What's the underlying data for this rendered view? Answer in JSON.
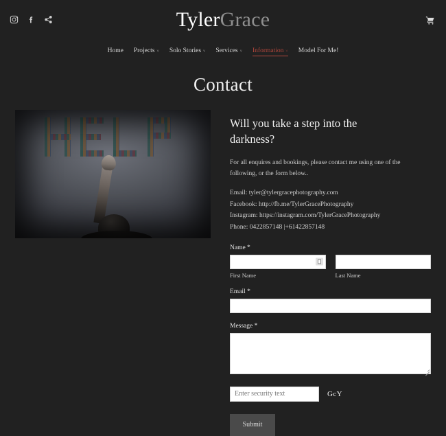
{
  "site": {
    "brand_first": "Tyler",
    "brand_second": "Grace",
    "social": [
      {
        "name": "instagram-icon",
        "label": "Instagram"
      },
      {
        "name": "facebook-icon",
        "label": "Facebook"
      },
      {
        "name": "share-icon",
        "label": "Share"
      }
    ],
    "cart_label": "Cart"
  },
  "nav": {
    "items": [
      {
        "label": "Home",
        "caret": "",
        "active": false
      },
      {
        "label": "Projects",
        "caret": "˅",
        "active": false
      },
      {
        "label": "Solo Stories",
        "caret": "˅",
        "active": false
      },
      {
        "label": "Services",
        "caret": "˅",
        "active": false
      },
      {
        "label": "Information",
        "caret": "˅",
        "active": true
      },
      {
        "label": "Model For Me!",
        "caret": "",
        "active": false
      }
    ],
    "active_color": "#b5473c"
  },
  "page": {
    "title": "Contact"
  },
  "photo": {
    "alt": "Person reaching up toward the word HELP spelled out in photographs on a dark wall",
    "word": "HELP"
  },
  "main": {
    "headline": "Will you take a step into the darkness?",
    "intro": "For all enquires and bookings, please contact me using one of the following, or the form below..",
    "details": {
      "email": "Email: tyler@tylergracephotography.com",
      "facebook": "Facebook: http://fb.me/TylerGracePhotography",
      "instagram": "Instagram: https://instagram.com/TylerGracePhotography",
      "phone": "Phone: 0422857148  |+61422857148"
    }
  },
  "form": {
    "name_label": "Name *",
    "first_name_value": "",
    "first_name_placeholder": "",
    "first_name_sublabel": "First Name",
    "last_name_value": "",
    "last_name_placeholder": "",
    "last_name_sublabel": "Last Name",
    "email_label": "Email *",
    "email_value": "",
    "email_placeholder": "",
    "message_label": "Message *",
    "message_value": "",
    "message_placeholder": "",
    "captcha_placeholder": "Enter security text",
    "captcha_value": "",
    "captcha_text": "GcY",
    "submit_label": "Submit"
  },
  "colors": {
    "background": "#212121",
    "accent": "#b5473c",
    "text": "#e8e8e8",
    "field_bg": "#ffffff",
    "button_bg": "#4a4a4a"
  }
}
